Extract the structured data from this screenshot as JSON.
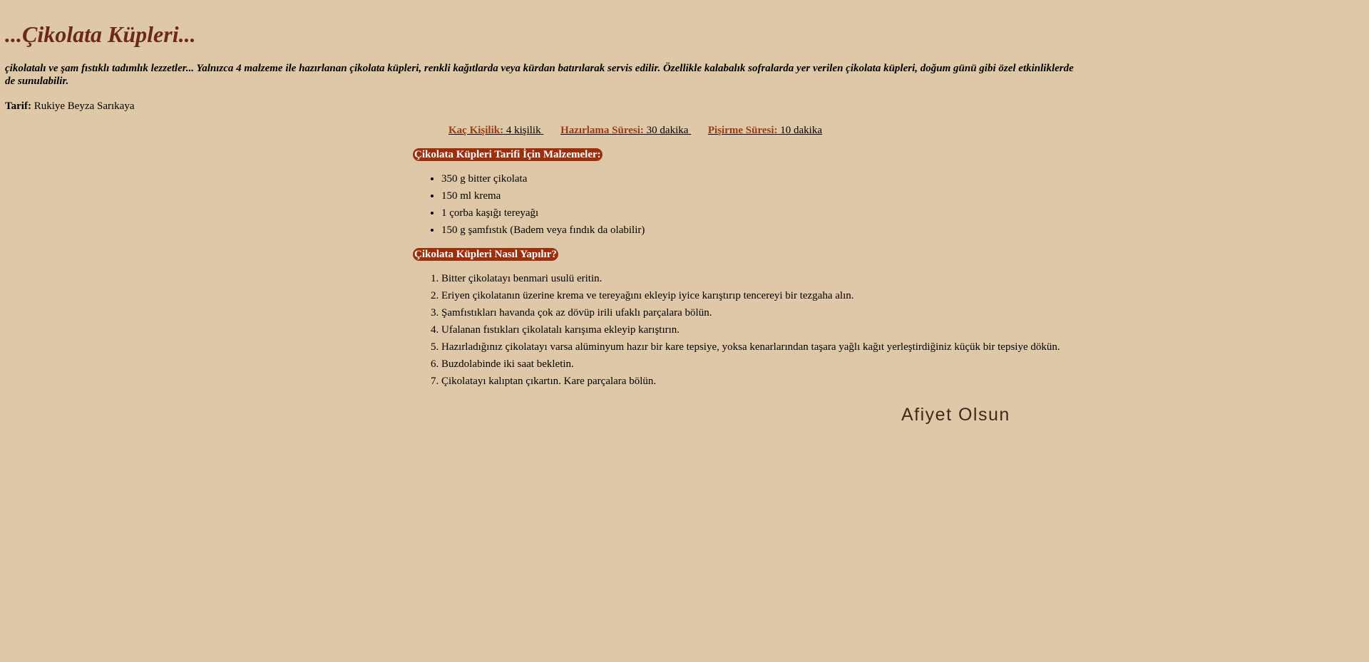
{
  "title": "...Çikolata Küpleri...",
  "intro": "çikolatalı ve şam fıstıklı tadımlık lezzetler... Yalnızca 4 malzeme ile hazırlanan çikolata küpleri, renkli kağıtlarda veya kürdan batırılarak servis edilir. Özellikle kalabalık sofralarda yer verilen çikolata küpleri, doğum günü gibi özel etkinliklerde de sunulabilir.",
  "author": {
    "label": "Tarif:",
    "name": "Rukiye Beyza Sarıkaya"
  },
  "meta": {
    "servings": {
      "label": "Kaç Kişilik:",
      "value": "4 kişilik"
    },
    "prep": {
      "label": "Hazırlama Süresi:",
      "value": "30 dakika"
    },
    "cook": {
      "label": "Pişirme Süresi:",
      "value": "10 dakika"
    }
  },
  "ingredients": {
    "heading": "Çikolata Küpleri Tarifi İçin Malzemeler:",
    "items": [
      "350 g bitter çikolata",
      "150 ml krema",
      "1 çorba kaşığı tereyağı",
      "150 g şamfıstık (Badem veya fındık da olabilir)"
    ]
  },
  "steps": {
    "heading": "Çikolata Küpleri Nasıl Yapılır?",
    "items": [
      "Bitter çikolatayı benmari usulü eritin.",
      "Eriyen çikolatanın üzerine krema ve tereyağını ekleyip iyice karıştırıp tencereyi bir tezgaha alın.",
      "Şamfıstıkları havanda çok az dövüp irili ufaklı parçalara bölün.",
      "Ufalanan fıstıkları çikolatalı karışıma ekleyip karıştırın.",
      "Hazırladığınız çikolatayı varsa alüminyum hazır bir kare tepsiye, yoksa kenarlarından taşara yağlı kağıt yerleştirdiğiniz küçük bir tepsiye dökün.",
      "Buzdolabinde iki saat bekletin.",
      "Çikolatayı kalıptan çıkartın. Kare parçalara bölün."
    ]
  },
  "closing": "Afiyet Olsun",
  "colors": {
    "background": "#dfc8a8",
    "title": "#6b2a16",
    "heading_bg": "#9b2f0e",
    "meta_label": "#9a3d12"
  }
}
